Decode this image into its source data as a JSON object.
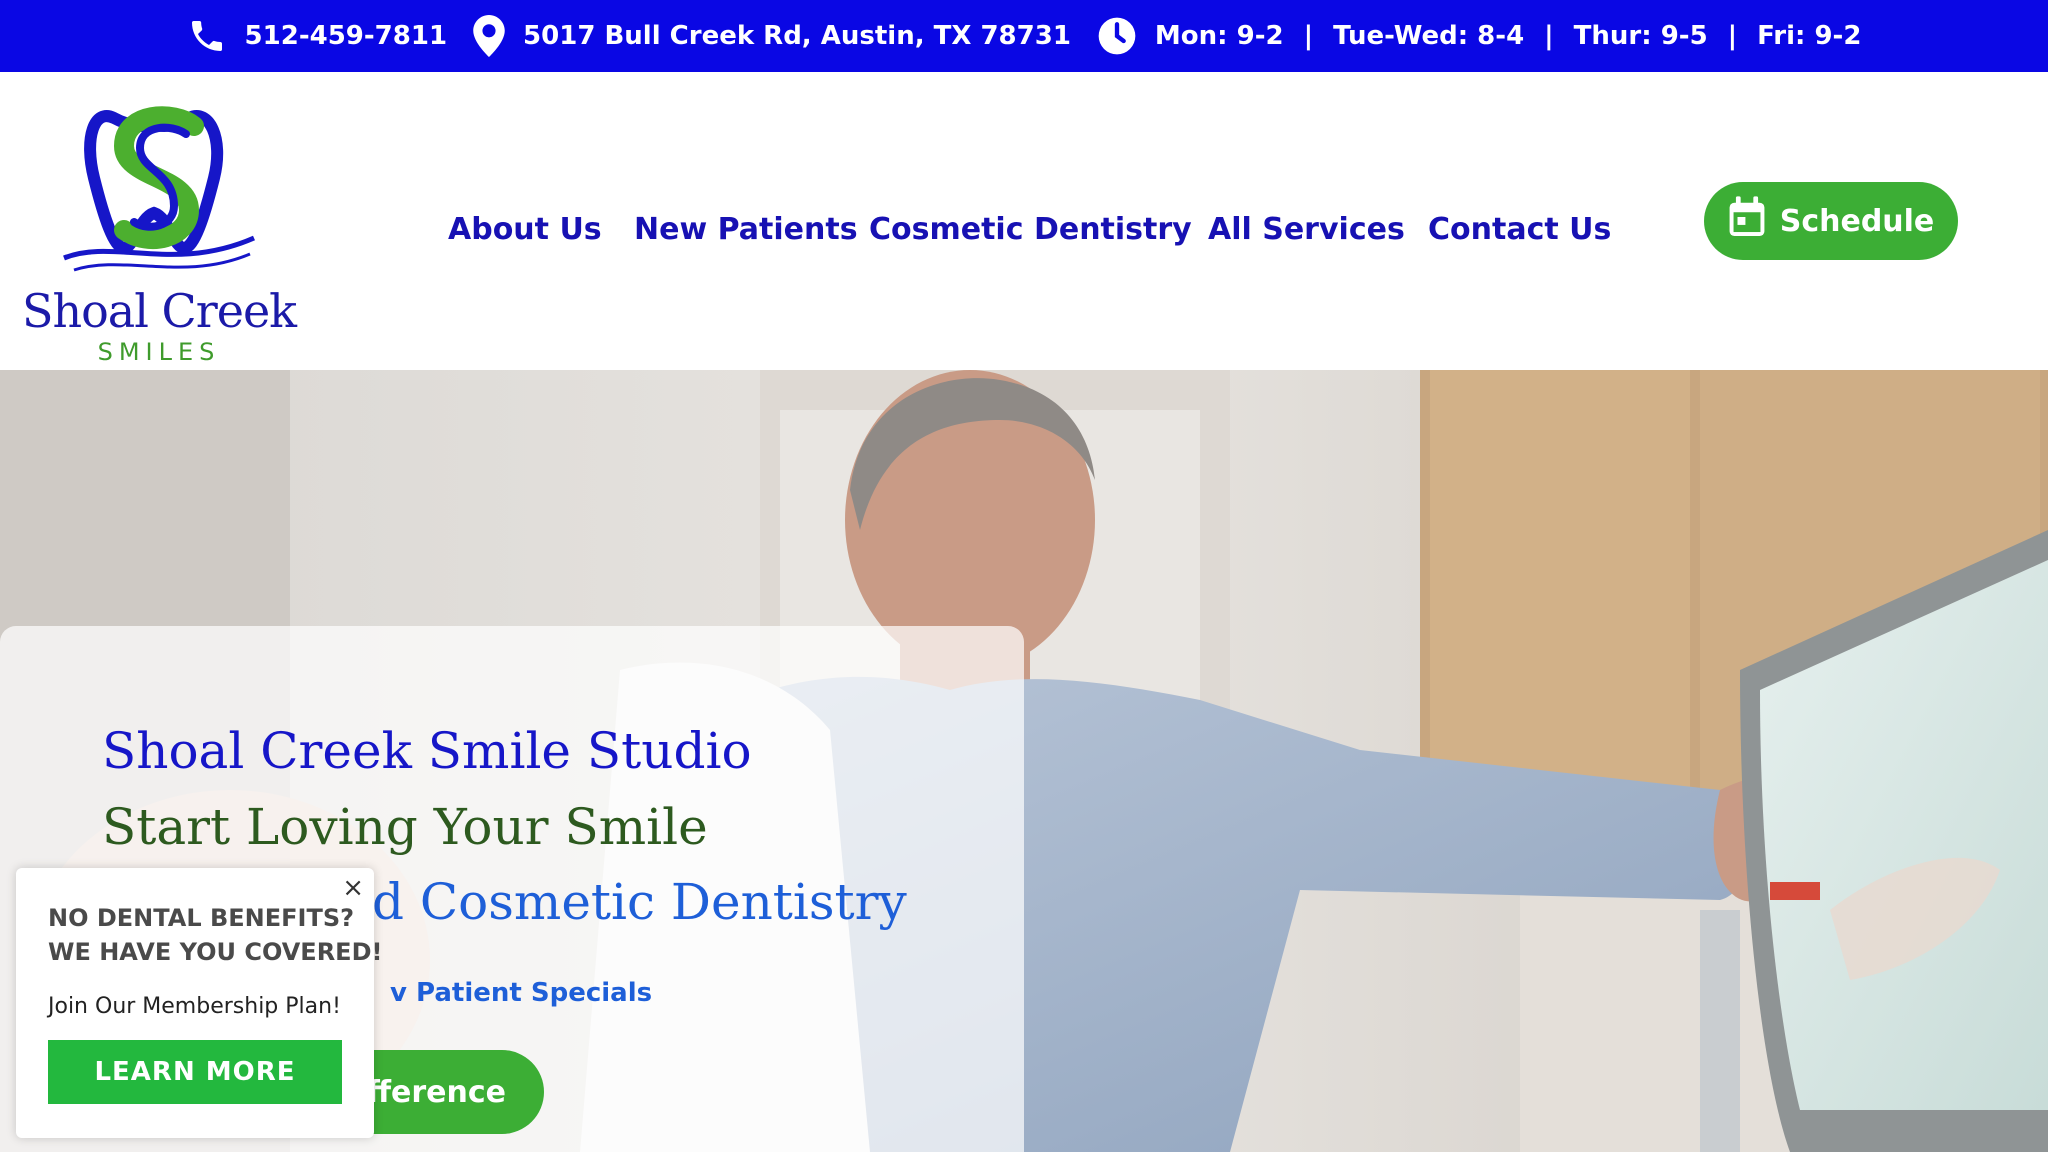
{
  "colors": {
    "topbar_bg": "#0a07e4",
    "nav_text": "#1711b3",
    "accent_green": "#3cae35",
    "popup_cta": "#23b83e"
  },
  "topbar": {
    "phone_icon": "phone-icon",
    "phone": "512-459-7811",
    "location_icon": "map-pin-icon",
    "address": "5017 Bull Creek Rd, Austin, TX 78731",
    "hours_icon": "clock-icon",
    "hours": [
      "Mon: 9-2",
      "Tue-Wed: 8-4",
      "Thur: 9-5",
      "Fri: 9-2"
    ],
    "hours_separator": "|"
  },
  "logo": {
    "name": "Shoal Creek",
    "sub": "SMILES"
  },
  "nav": {
    "items": [
      "About Us",
      "New Patients",
      "Cosmetic Dentistry",
      "All Services",
      "Contact Us"
    ],
    "schedule_icon": "calendar-icon",
    "schedule_label": "Schedule"
  },
  "hero": {
    "title": "Shoal Creek Smile Studio",
    "subtitle1": "Start Loving Your Smile",
    "subtitle2_visible": "d Cosmetic Dentistry",
    "link_visible": "v Patient Specials",
    "button_visible": "Difference"
  },
  "popup": {
    "close": "×",
    "heading1": "NO DENTAL BENEFITS?",
    "heading2": "WE HAVE YOU COVERED!",
    "body": "Join Our Membership Plan!",
    "cta": "LEARN MORE"
  }
}
